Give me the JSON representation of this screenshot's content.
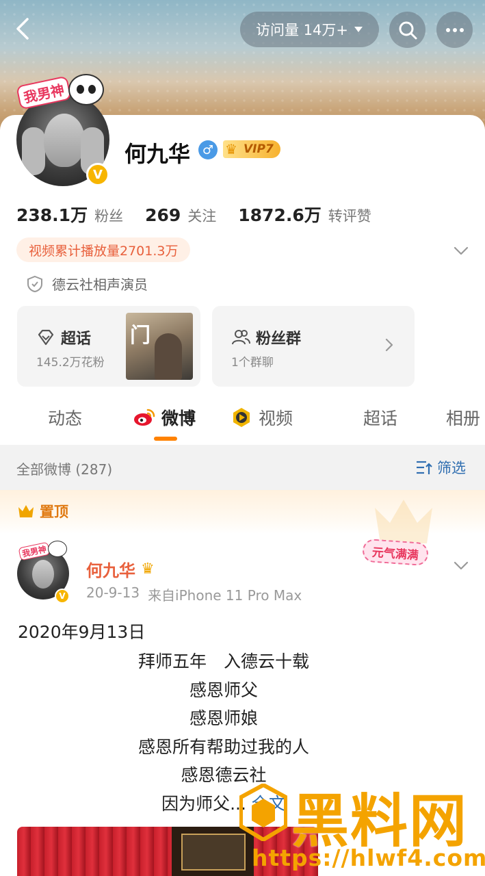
{
  "header": {
    "visits_label": "访问量 14万+",
    "icons": [
      "back-icon",
      "search-icon",
      "more-icon"
    ]
  },
  "profile": {
    "avatar_sticker": "我男神",
    "name": "何九华",
    "gender_symbol": "♂",
    "vip_label": "VIP7",
    "stats": [
      {
        "num": "238.1万",
        "label": "粉丝"
      },
      {
        "num": "269",
        "label": "关注"
      },
      {
        "num": "1872.6万",
        "label": "转评赞"
      }
    ],
    "play_count": "视频累计播放量2701.3万",
    "certification": "德云社相声演员"
  },
  "tiles": {
    "supertopic": {
      "title": "超话",
      "sub": "145.2万花粉"
    },
    "fan_group": {
      "title": "粉丝群",
      "sub": "1个群聊"
    }
  },
  "tabs": [
    {
      "label": "动态"
    },
    {
      "label": "微博"
    },
    {
      "label": "视频"
    },
    {
      "label": "超话"
    },
    {
      "label": "相册"
    }
  ],
  "filter_bar": {
    "count": "全部微博 (287)",
    "filter_label": "筛选"
  },
  "pinned": {
    "label": "置顶"
  },
  "post": {
    "author": "何九华",
    "date": "20-9-13",
    "source": "来自iPhone 11 Pro Max",
    "badge": "元气满满",
    "first_line": "2020年9月13日",
    "lines": [
      "拜师五年　入德云十载",
      "感恩师父",
      "感恩师娘",
      "感恩所有帮助过我的人",
      "感恩德云社"
    ],
    "last_line": "因为师父... ",
    "more_label": "全文"
  },
  "watermark": {
    "text": "黑料网",
    "url": "https://hlwf4.com"
  },
  "colors": {
    "accent_orange": "#ff8200",
    "link_blue": "#2f6eb0",
    "name_orange": "#e8603c",
    "watermark_gold": "#f4a300"
  }
}
